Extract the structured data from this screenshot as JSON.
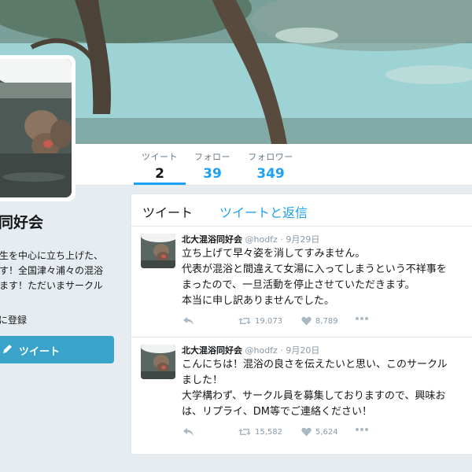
{
  "nav": {
    "stats": [
      {
        "label": "ツイート",
        "value": "2"
      },
      {
        "label": "フォロー",
        "value": "39"
      },
      {
        "label": "フォロワー",
        "value": "349"
      }
    ]
  },
  "profile": {
    "name_partial": "同好会",
    "bio_lines": [
      "生を中心に立ち上げた、",
      "す！全国津々浦々の混浴",
      "ます！ただいまサークル"
    ],
    "joined_partial": "に登録",
    "tweet_button": "ツイート"
  },
  "timeline": {
    "tabs": [
      "ツイート",
      "ツイートと返信"
    ],
    "tweets": [
      {
        "name": "北大混浴同好会",
        "handle": "@hodfz",
        "dot": "·",
        "date": "9月29日",
        "lines": [
          "立ち上げて早々姿を消してすみません。",
          "代表が混浴と間違えて女湯に入ってしまうという不祥事を",
          "まったので、一旦活動を停止させていただきます。",
          "本当に申し訳ありませんでした。"
        ],
        "retweets": "19,073",
        "likes": "8,789"
      },
      {
        "name": "北大混浴同好会",
        "handle": "@hodfz",
        "dot": "·",
        "date": "9月20日",
        "lines": [
          "こんにちは！混浴の良さを伝えたいと思い、このサークル",
          "ました！",
          "大学構わず、サークル員を募集しておりますので、興味お",
          "は、リプライ、DM等でご連絡ください！"
        ],
        "retweets": "15,582",
        "likes": "5,624"
      }
    ]
  }
}
